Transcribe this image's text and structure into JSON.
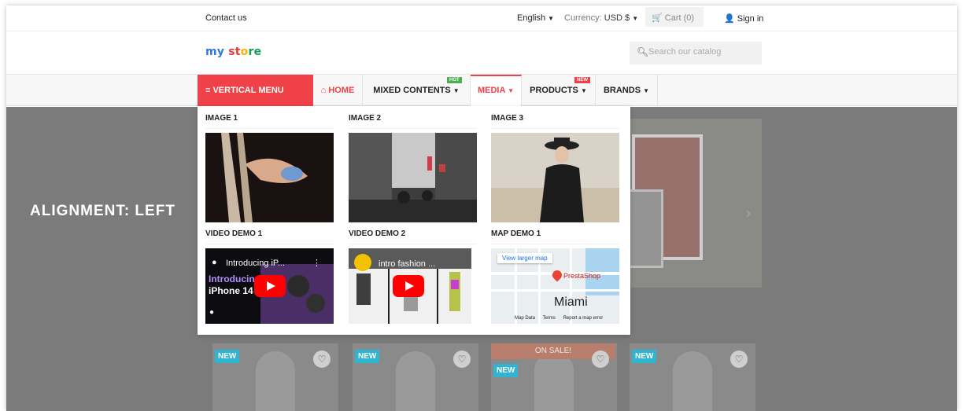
{
  "topbar": {
    "contact": "Contact us",
    "language": "English",
    "currency_label": "Currency:",
    "currency_value": "USD $",
    "cart": "Cart (0)",
    "signin": "Sign in"
  },
  "header": {
    "logo": {
      "part1": "my",
      "part2": "st",
      "part3": "o",
      "part4": "re"
    },
    "search_placeholder": "Search our catalog"
  },
  "nav": {
    "vertical_menu": "≡ VERTICAL MENU",
    "home": "HOME",
    "mixed": "MIXED CONTENTS",
    "mixed_badge": "HOT",
    "media": "MEDIA",
    "products": "PRODUCTS",
    "products_badge": "NEW",
    "brands": "BRANDS"
  },
  "hero": {
    "title": "ALIGNMENT: LEFT"
  },
  "mega": {
    "image1": "IMAGE 1",
    "image2": "IMAGE 2",
    "image3": "IMAGE 3",
    "video1": "VIDEO DEMO 1",
    "video2": "VIDEO DEMO 2",
    "map1": "MAP DEMO 1",
    "video1_title": "Introducing iP...",
    "video1_overlay_line1": "Introducin",
    "video1_overlay_line2": "iPhone 14",
    "video2_title": "intro fashion ...",
    "map_link": "View larger map",
    "map_store": "PrestaShop",
    "map_city": "Miami",
    "map_footer": [
      "Map Data",
      "Terms",
      "Report a map error"
    ]
  },
  "products": [
    {
      "tag": "NEW",
      "sale": ""
    },
    {
      "tag": "NEW",
      "sale": ""
    },
    {
      "tag": "NEW",
      "sale": "ON SALE!"
    },
    {
      "tag": "NEW",
      "sale": ""
    }
  ],
  "colors": {
    "accent": "#ef4147",
    "tag": "#2fb5d2"
  }
}
